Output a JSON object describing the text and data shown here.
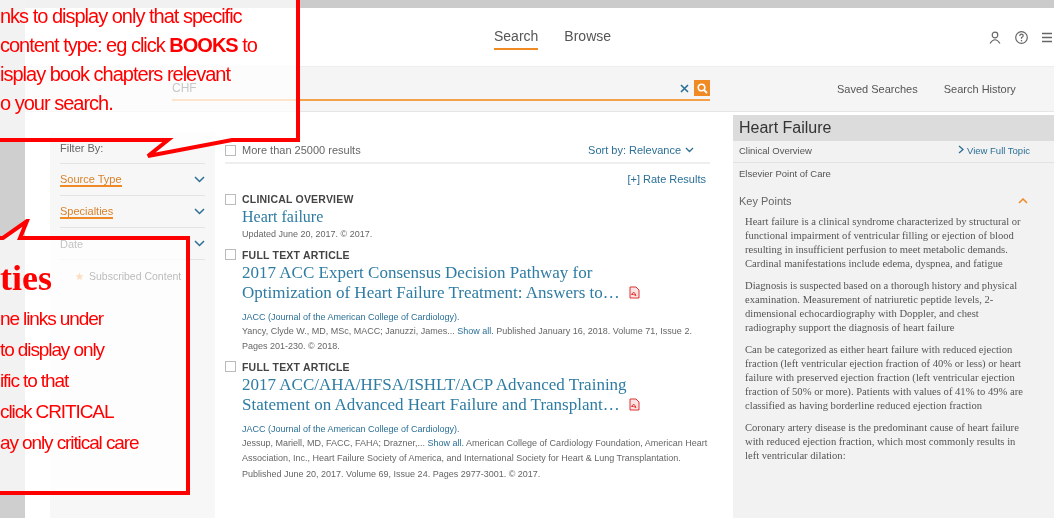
{
  "nav": {
    "tabs": [
      {
        "label": "Search",
        "selected": true
      },
      {
        "label": "Browse",
        "selected": false
      }
    ]
  },
  "search": {
    "value": "CHF",
    "links": [
      "Saved Searches",
      "Search History"
    ]
  },
  "filters": {
    "heading": "Filter By:",
    "items": [
      {
        "label": "Source Type",
        "active": true
      },
      {
        "label": "Specialties",
        "active": true
      },
      {
        "label": "Date",
        "active": false
      }
    ],
    "subscribed": "Subscribed Content"
  },
  "results": {
    "count": "More than 25000 results",
    "select_all_checked": false,
    "sort": "Sort by: Relevance",
    "rate": "[+] Rate Results",
    "items": [
      {
        "checked": false,
        "type": "CLINICAL OVERVIEW",
        "title": "Heart failure",
        "pdf": false,
        "updated": "Updated June 20, 2017. © 2017."
      },
      {
        "checked": false,
        "type": "FULL TEXT ARTICLE",
        "title": "2017 ACC Expert Consensus Decision Pathway for Optimization of Heart Failure Treatment: Answers to…",
        "pdf": true,
        "source": "JACC (Journal of the American College of Cardiology).",
        "authors": "Yancy, Clyde W., MD, MSc, MACC; Januzzi, James...",
        "show_all": "Show all.",
        "details": "Published January 16, 2018. Volume 71, Issue 2. Pages 201-230. © 2018."
      },
      {
        "checked": false,
        "type": "FULL TEXT ARTICLE",
        "title": "2017 ACC/AHA/HFSA/ISHLT/ACP Advanced Training Statement on Advanced Heart Failure and Transplant…",
        "pdf": true,
        "source": "JACC (Journal of the American College of Cardiology).",
        "authors": "Jessup, Mariell, MD, FACC, FAHA; Drazner,...",
        "show_all": "Show all.",
        "details": "American College of Cardiology Foundation, American Heart Association, Inc., Heart Failure Society of America, and International Society for Heart & Lung Transplantation. Published June 20, 2017. Volume 69, Issue 24. Pages 2977-3001. © 2017."
      }
    ]
  },
  "topic": {
    "title": "Heart Failure",
    "subtitle": "Clinical Overview",
    "link": "View Full Topic",
    "source": "Elsevier Point of Care",
    "section": "Key Points",
    "expanded": true,
    "paragraphs": [
      "Heart failure is a clinical syndrome characterized by structural or functional impairment of ventricular filling or ejection of blood resulting in insufficient perfusion to meet metabolic demands. Cardinal manifestations include edema, dyspnea, and fatigue",
      "Diagnosis is suspected based on a thorough history and physical examination. Measurement of natriuretic peptide levels, 2-dimensional echocardiography with Doppler, and chest radiography support the diagnosis of heart failure",
      "Can be categorized as either heart failure with reduced ejection fraction (left ventricular ejection fraction of 40% or less) or heart failure with preserved ejection fraction (left ventricular ejection fraction of 50% or more). Patients with values of 41% to 49% are classified as having borderline reduced ejection fraction",
      "Coronary artery disease is the predominant cause of heart failure with reduced ejection fraction, which most commonly results in left ventricular dilation:"
    ]
  },
  "callouts": [
    {
      "lines": [
        "nks to display only that specific",
        "content type: eg click **BOOKS** to",
        "isplay book chapters relevant",
        "o your search."
      ]
    },
    {
      "heading": "ties",
      "lines": [
        "ne links under",
        "to display only",
        "ific to that",
        "click CRITICAL",
        "ay only critical care"
      ]
    }
  ]
}
